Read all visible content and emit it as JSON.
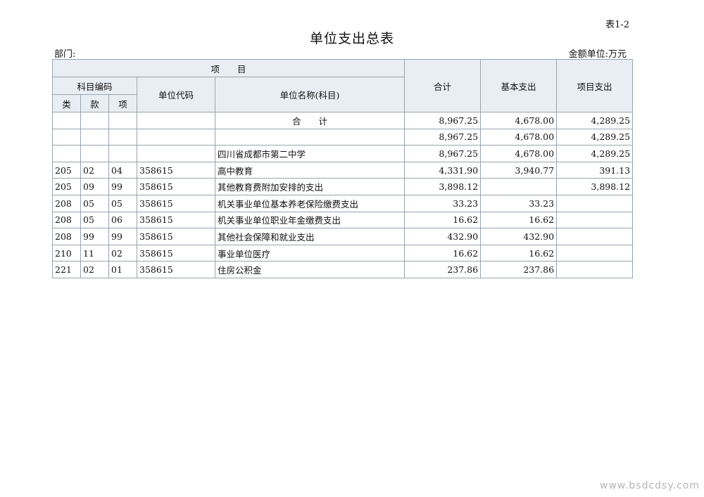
{
  "header": {
    "table_no": "表1-2",
    "title": "单位支出总表",
    "dept_label": "部门:",
    "unit_label": "金额单位:万元"
  },
  "columns": {
    "project": "项　　目",
    "subject_code": "科目编码",
    "lei": "类",
    "kuan": "款",
    "xiang": "项",
    "unit_code": "单位代码",
    "unit_name": "单位名称(科目)",
    "total": "合计",
    "basic": "基本支出",
    "project_exp": "项目支出"
  },
  "rows": [
    {
      "lei": "",
      "kuan": "",
      "xiang": "",
      "unit_code": "",
      "name": "合　　计",
      "total": "8,967.25",
      "basic": "4,678.00",
      "project": "4,289.25"
    },
    {
      "lei": "",
      "kuan": "",
      "xiang": "",
      "unit_code": "",
      "name": "",
      "total": "8,967.25",
      "basic": "4,678.00",
      "project": "4,289.25"
    },
    {
      "lei": "",
      "kuan": "",
      "xiang": "",
      "unit_code": "",
      "name": "四川省成都市第二中学",
      "total": "8,967.25",
      "basic": "4,678.00",
      "project": "4,289.25"
    },
    {
      "lei": "205",
      "kuan": "02",
      "xiang": "04",
      "unit_code": "358615",
      "name": "高中教育",
      "total": "4,331.90",
      "basic": "3,940.77",
      "project": "391.13"
    },
    {
      "lei": "205",
      "kuan": "09",
      "xiang": "99",
      "unit_code": "358615",
      "name": "其他教育费附加安排的支出",
      "total": "3,898.12",
      "basic": "",
      "project": "3,898.12"
    },
    {
      "lei": "208",
      "kuan": "05",
      "xiang": "05",
      "unit_code": "358615",
      "name": "机关事业单位基本养老保险缴费支出",
      "total": "33.23",
      "basic": "33.23",
      "project": ""
    },
    {
      "lei": "208",
      "kuan": "05",
      "xiang": "06",
      "unit_code": "358615",
      "name": "机关事业单位职业年金缴费支出",
      "total": "16.62",
      "basic": "16.62",
      "project": ""
    },
    {
      "lei": "208",
      "kuan": "99",
      "xiang": "99",
      "unit_code": "358615",
      "name": "其他社会保障和就业支出",
      "total": "432.90",
      "basic": "432.90",
      "project": ""
    },
    {
      "lei": "210",
      "kuan": "11",
      "xiang": "02",
      "unit_code": "358615",
      "name": "事业单位医疗",
      "total": "16.62",
      "basic": "16.62",
      "project": ""
    },
    {
      "lei": "221",
      "kuan": "02",
      "xiang": "01",
      "unit_code": "358615",
      "name": "住房公积金",
      "total": "237.86",
      "basic": "237.86",
      "project": ""
    }
  ],
  "watermark": "www.bsdcdsy.com"
}
